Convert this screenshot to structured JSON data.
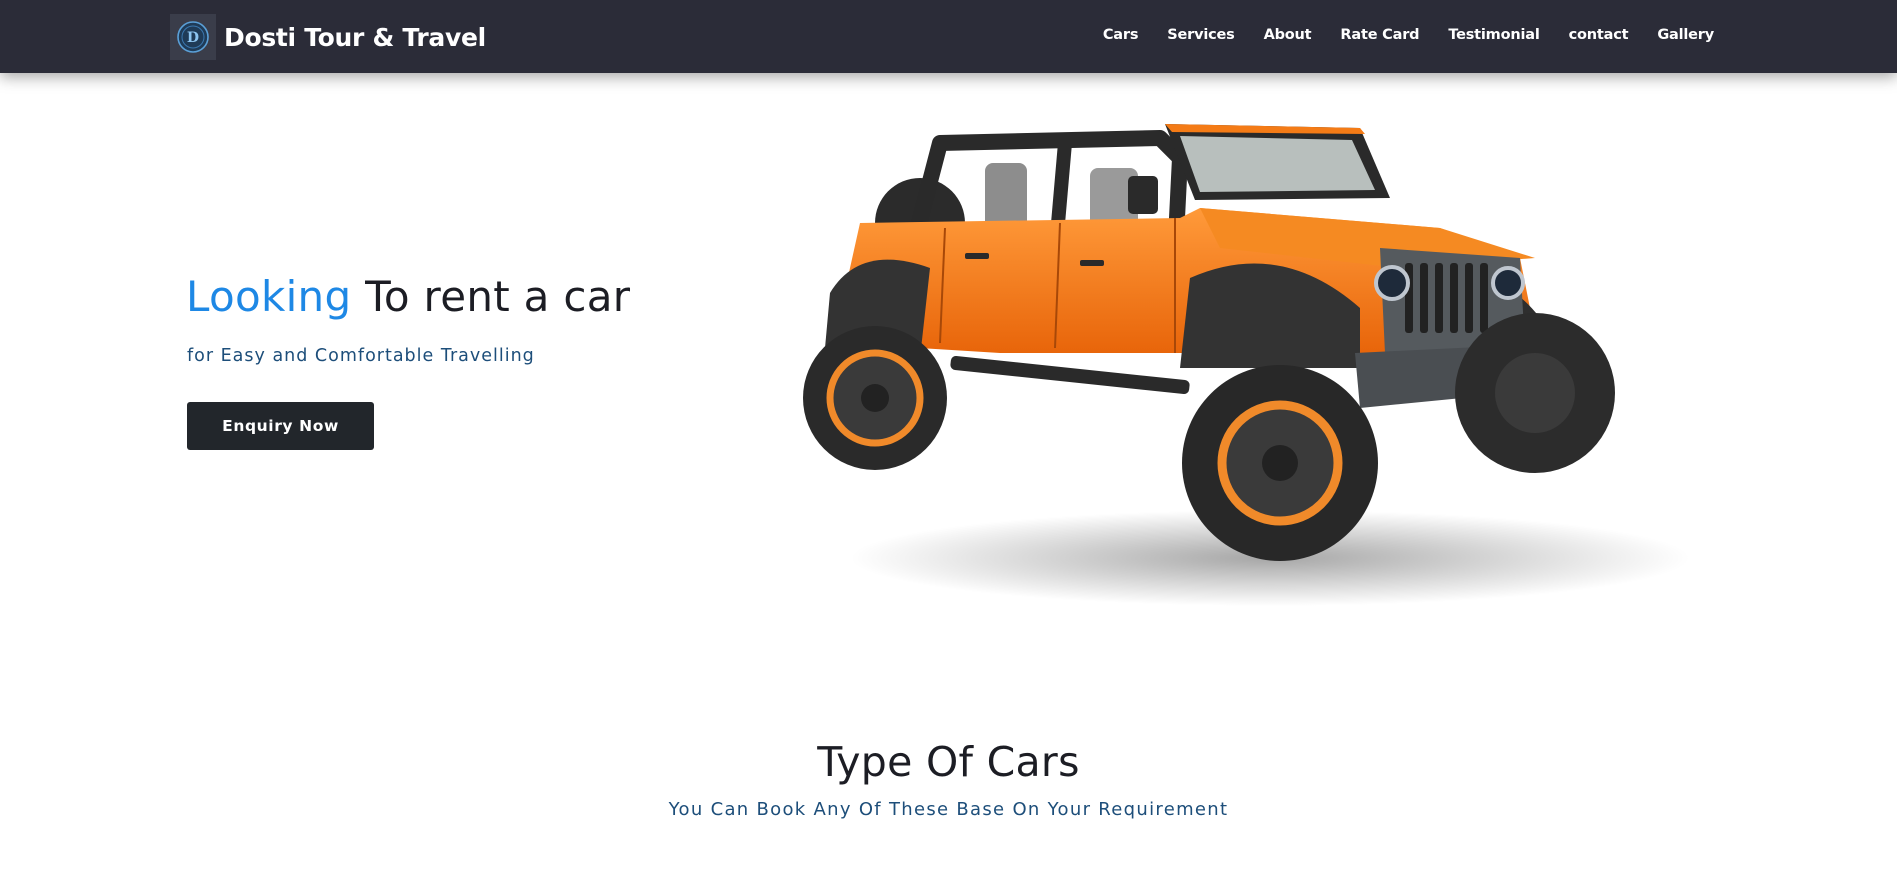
{
  "brand": {
    "name": "Dosti Tour & Travel",
    "logo_letter": "D"
  },
  "nav": {
    "items": [
      {
        "label": "Cars"
      },
      {
        "label": "Services"
      },
      {
        "label": "About"
      },
      {
        "label": "Rate Card"
      },
      {
        "label": "Testimonial"
      },
      {
        "label": "contact"
      },
      {
        "label": "Gallery"
      }
    ]
  },
  "hero": {
    "title_accent": "Looking",
    "title_rest": " To rent a car",
    "subtitle": "for Easy and Comfortable Travelling",
    "button_label": "Enquiry Now",
    "image_icon": "orange-jeep-image"
  },
  "section": {
    "title": "Type Of Cars",
    "subtitle": "You Can Book Any Of These Base On Your Requirement"
  },
  "colors": {
    "navbar_bg": "#2b2c38",
    "accent_blue": "#1e88e5",
    "subtitle_blue": "#1d4e7a",
    "button_bg": "#22262b",
    "jeep_orange": "#f47b16"
  }
}
